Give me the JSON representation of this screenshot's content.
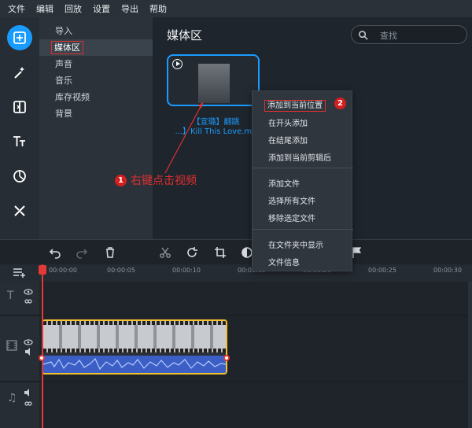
{
  "menubar": {
    "items": [
      "文件",
      "编辑",
      "回放",
      "设置",
      "导出",
      "帮助"
    ]
  },
  "categories": [
    "导入",
    "媒体区",
    "声音",
    "音乐",
    "库存视频",
    "背景"
  ],
  "selected_category": "媒体区",
  "media": {
    "title": "媒体区",
    "search_placeholder": "查找",
    "clip_name_line1": "【宣璐】翻跳",
    "clip_name_line2": "...】Kill This Love.mp"
  },
  "annotations": {
    "step1_badge": "1",
    "step1_text": "右键点击视频",
    "step2_badge": "2"
  },
  "context_menu": {
    "group1": [
      "添加到当前位置",
      "在开头添加",
      "在结尾添加",
      "添加到当前剪辑后"
    ],
    "group2": [
      "添加文件",
      "选择所有文件",
      "移除选定文件"
    ],
    "group3": [
      "在文件夹中显示",
      "文件信息"
    ]
  },
  "ruler": {
    "labels": [
      "00:00:00",
      "00:00:05",
      "00:00:10",
      "00:00:15",
      "00:00:20",
      "00:00:25",
      "00:00:30"
    ]
  },
  "colors": {
    "accent": "#1a9cff",
    "annotation_red": "#e03030",
    "clip_border": "#f2c230",
    "playhead": "#e53935",
    "audio": "#3b5fc4"
  }
}
